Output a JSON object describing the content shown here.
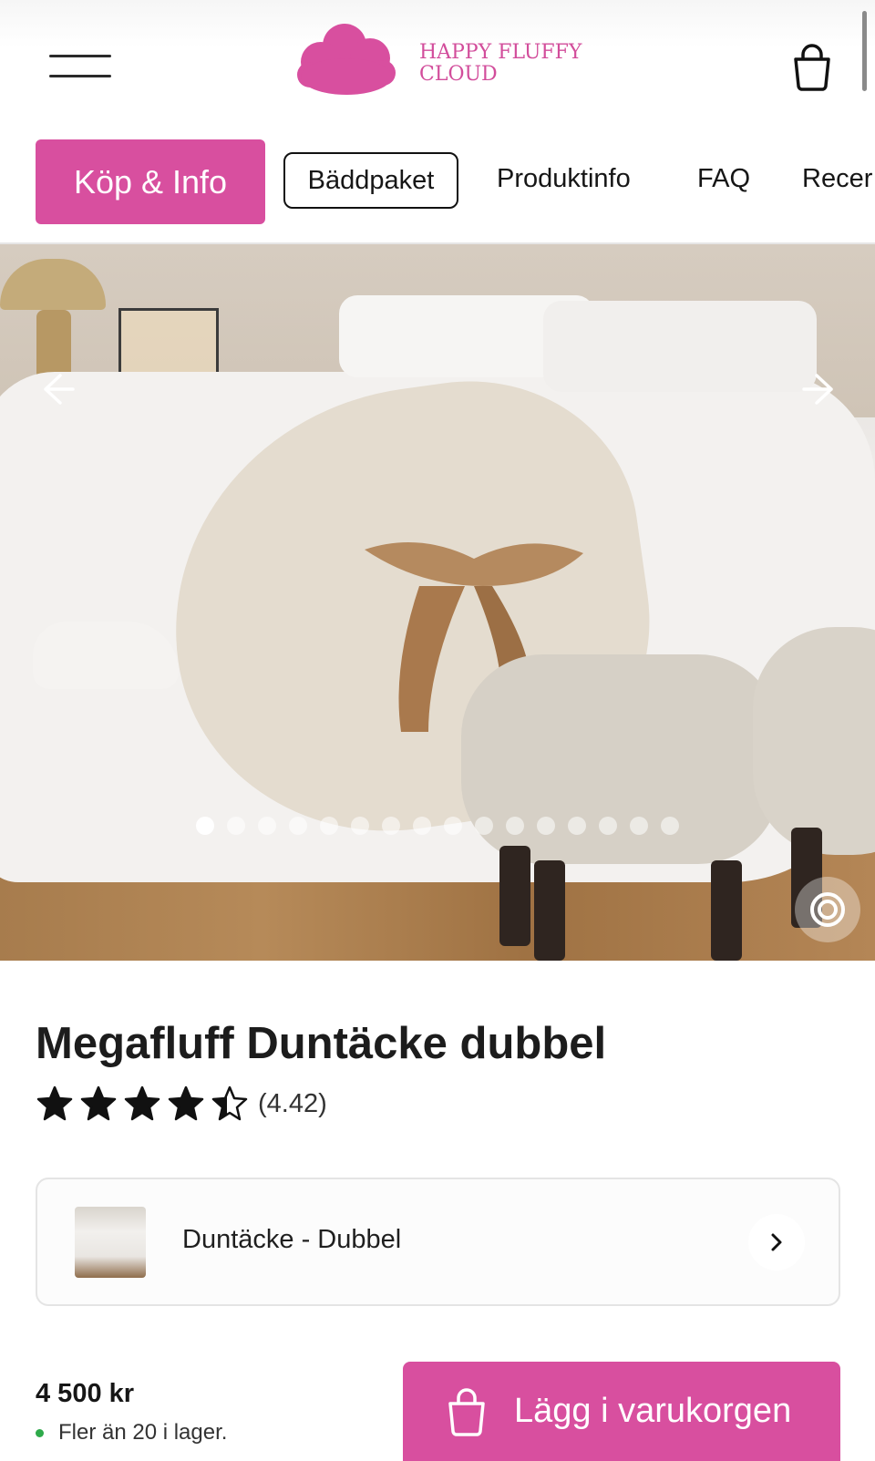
{
  "header": {
    "brand_line1": "HAPPY FLUFFY",
    "brand_line2": "CLOUD",
    "brand_color": "#d24d9b",
    "menu_icon": "hamburger-menu-icon",
    "cart_icon": "shopping-bag-icon"
  },
  "tabs": [
    {
      "label": "Köp & Info",
      "active": true
    },
    {
      "label": "Bäddpaket"
    },
    {
      "label": "Produktinfo"
    },
    {
      "label": "FAQ"
    },
    {
      "label": "Recer"
    }
  ],
  "gallery": {
    "slide_count": 16,
    "active_slide": 1,
    "prev_icon": "arrow-left-icon",
    "next_icon": "arrow-right-icon",
    "ar_icon": "view-in-ar-icon"
  },
  "product": {
    "title": "Megafluff Duntäcke dubbel",
    "rating": 4.42,
    "rating_text": "(4.42)",
    "stars_max": 5,
    "variant_label": "Duntäcke - Dubbel",
    "price": "4 500 kr",
    "stock": "Fler än 20 i lager.",
    "stock_color": "#2eaa4a",
    "add_to_cart": "Lägg i varukorgen",
    "accent_color": "#d84f9f"
  }
}
